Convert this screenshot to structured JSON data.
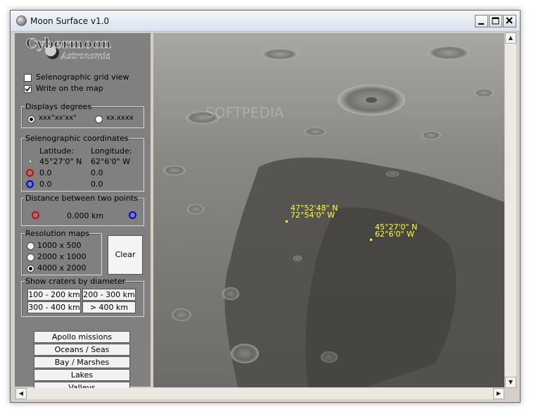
{
  "window": {
    "title": "Moon Surface v1.0"
  },
  "logo": {
    "text": "Cybermoon",
    "sub": "Astronomia"
  },
  "options": {
    "grid_view": {
      "label": "Selenographic grid view",
      "checked": false
    },
    "write_on_map": {
      "label": "Write on the map",
      "checked": true
    }
  },
  "degrees": {
    "title": "Displays degrees",
    "opt1": "xxx°xx'xx\"",
    "opt2": "xx.xxxx"
  },
  "coords": {
    "title": "Selenographic coordinates",
    "lat_header": "Latitude:",
    "lon_header": "Longitude:",
    "rows": [
      {
        "lat": "45°27'0\" N",
        "lon": "62°6'0\" W"
      },
      {
        "lat": "0.0",
        "lon": "0.0"
      },
      {
        "lat": "0.0",
        "lon": "0.0"
      }
    ]
  },
  "distance": {
    "title": "Distance between two points",
    "value": "0.000 km"
  },
  "resolution": {
    "title": "Resolution maps",
    "options": [
      "1000 x 500",
      "2000 x 1000",
      "4000 x 2000"
    ],
    "selected": 2
  },
  "clear_label": "Clear",
  "craters": {
    "title": "Show craters by diameter",
    "buttons": [
      "100 - 200 km",
      "200 - 300 km",
      "300 - 400 km",
      "> 400 km"
    ]
  },
  "nav_buttons": [
    "Apollo missions",
    "Oceans / Seas",
    "Bay / Marshes",
    "Lakes",
    "Valleys"
  ],
  "map": {
    "watermark": "SOFTPEDIA",
    "point1": {
      "lat": "47°52'48\" N",
      "lon": "72°54'0\" W"
    },
    "point2": {
      "lat": "45°27'0\" N",
      "lon": "62°6'0\" W"
    }
  },
  "colors": {
    "marker_text": "#ffff33",
    "ring_red": "#e00000",
    "ring_blue": "#0000e0"
  }
}
